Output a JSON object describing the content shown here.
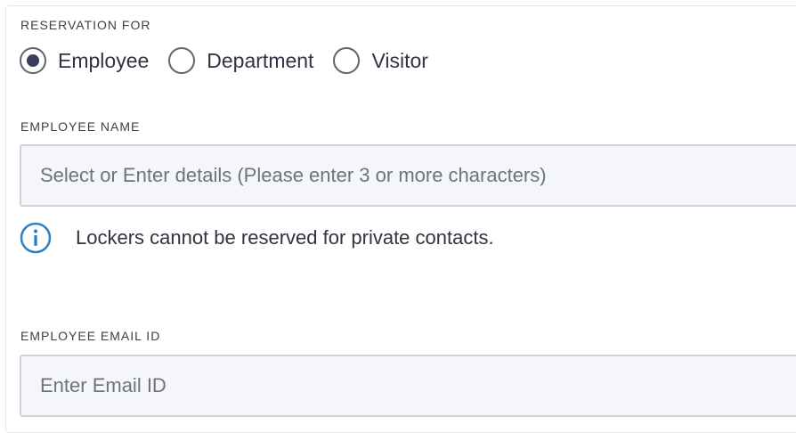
{
  "reservation": {
    "label": "RESERVATION FOR",
    "options": [
      {
        "label": "Employee",
        "selected": true
      },
      {
        "label": "Department",
        "selected": false
      },
      {
        "label": "Visitor",
        "selected": false
      }
    ]
  },
  "employee_name": {
    "label": "EMPLOYEE NAME",
    "placeholder": "Select or Enter details (Please enter 3 or more characters)",
    "value": ""
  },
  "info": {
    "icon": "info-icon",
    "text": "Lockers cannot be reserved for private contacts.",
    "icon_color": "#2f7fc1"
  },
  "employee_email": {
    "label": "EMPLOYEE EMAIL ID",
    "placeholder": "Enter Email ID",
    "value": ""
  }
}
